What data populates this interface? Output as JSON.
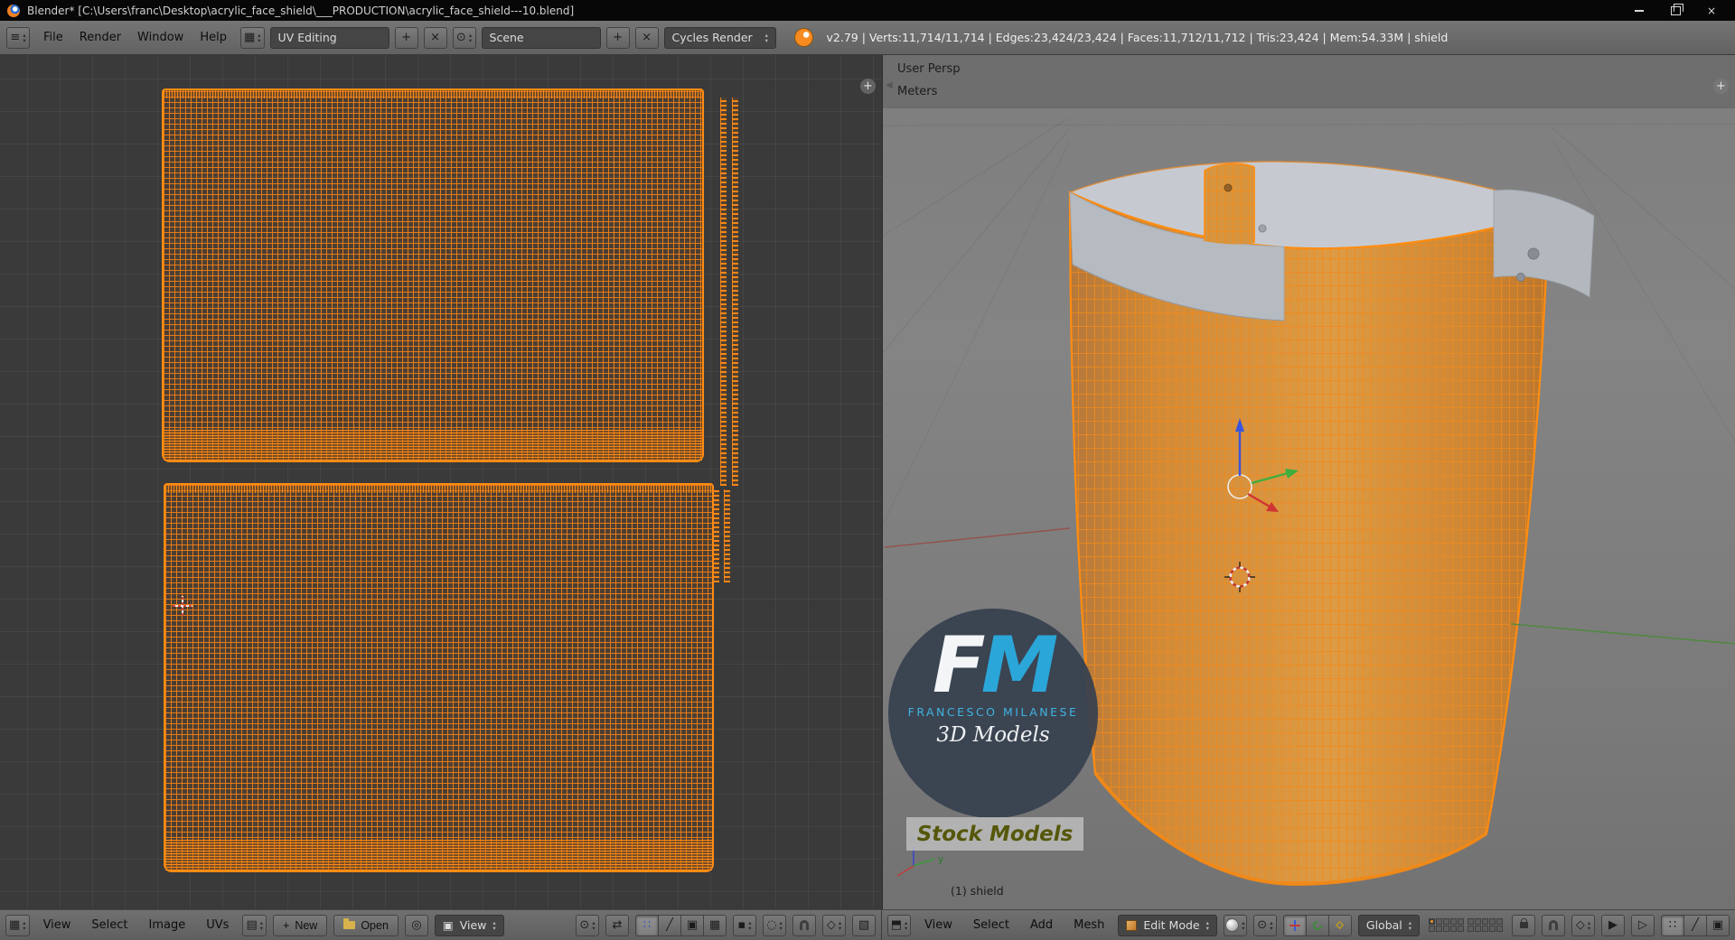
{
  "window": {
    "title": "Blender* [C:\\Users\\franc\\Desktop\\acrylic_face_shield\\___PRODUCTION\\acrylic_face_shield---10.blend]"
  },
  "infobar": {
    "menus": [
      "File",
      "Render",
      "Window",
      "Help"
    ],
    "layout": "UV Editing",
    "scene": "Scene",
    "engine": "Cycles Render",
    "stats": "v2.79 | Verts:11,714/11,714 | Edges:23,424/23,424 | Faces:11,712/11,712 | Tris:23,424 | Mem:54.33M | shield"
  },
  "uv_editor": {
    "menus": [
      "View",
      "Select",
      "Image",
      "UVs"
    ],
    "new_button": "New",
    "open_button": "Open",
    "mode_dropdown": "View"
  },
  "viewport": {
    "view_name": "User Persp",
    "unit_label": "Meters",
    "object_info": "(1) shield",
    "menus": [
      "View",
      "Select",
      "Add",
      "Mesh"
    ],
    "mode_dropdown": "Edit Mode",
    "orientation_dropdown": "Global",
    "axis_gizmo": {
      "y": "y",
      "z": "z"
    }
  },
  "watermark": {
    "initial_f": "F",
    "initial_m": "M",
    "name": "FRANCESCO MILANESE",
    "tagline": "3D Models",
    "banner": "Stock Models"
  },
  "colors": {
    "selection_orange": "#ff8c12",
    "header_gray": "#676767",
    "uv_background": "#3a3a3a",
    "logo_blue": "#2ba6d9",
    "banner_text": "#55570a"
  }
}
